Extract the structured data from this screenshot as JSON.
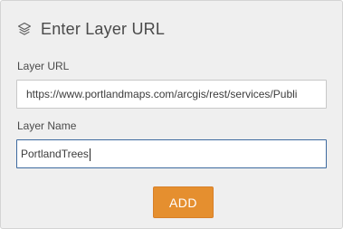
{
  "dialog": {
    "title": "Enter Layer URL",
    "icon": "layers-icon"
  },
  "fields": {
    "url": {
      "label": "Layer URL",
      "value": "https://www.portlandmaps.com/arcgis/rest/services/Publi"
    },
    "name": {
      "label": "Layer Name",
      "value": "PortlandTrees"
    }
  },
  "actions": {
    "add_label": "ADD"
  },
  "colors": {
    "panel_background": "#efefef",
    "add_button": "#e58f2f",
    "focused_border": "#3d6a9f"
  }
}
